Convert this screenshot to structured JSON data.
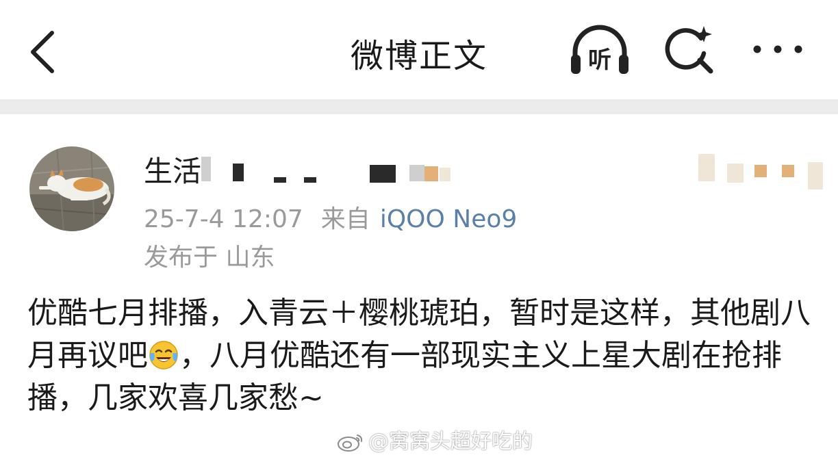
{
  "header": {
    "title": "微博正文",
    "back_icon": "chevron-left-icon",
    "listen_label": "听",
    "search_icon": "search-sparkle-icon",
    "more_icon": "more-dots-icon"
  },
  "post": {
    "author": {
      "name_visible": "生活",
      "avatar": "cat-photo-avatar"
    },
    "timestamp": "25-7-4 12:07",
    "source_prefix": "来自",
    "device": "iQOO Neo9",
    "location": "发布于 山东",
    "content": {
      "part1": "优酷七月排播，入青云＋樱桃琥珀，暂时是这样，其他剧八月再议吧",
      "emoji": "laughing-tears-emoji",
      "part2": "，八月优酷还有一部现实主义上星大剧在抢排播，几家欢喜几家愁~"
    }
  },
  "watermark": {
    "text": "@窝窝头超好吃的",
    "logo": "weibo-logo-icon"
  },
  "colors": {
    "link": "#5a7fa8",
    "meta": "#9a9a9a",
    "divider": "#ececec"
  }
}
